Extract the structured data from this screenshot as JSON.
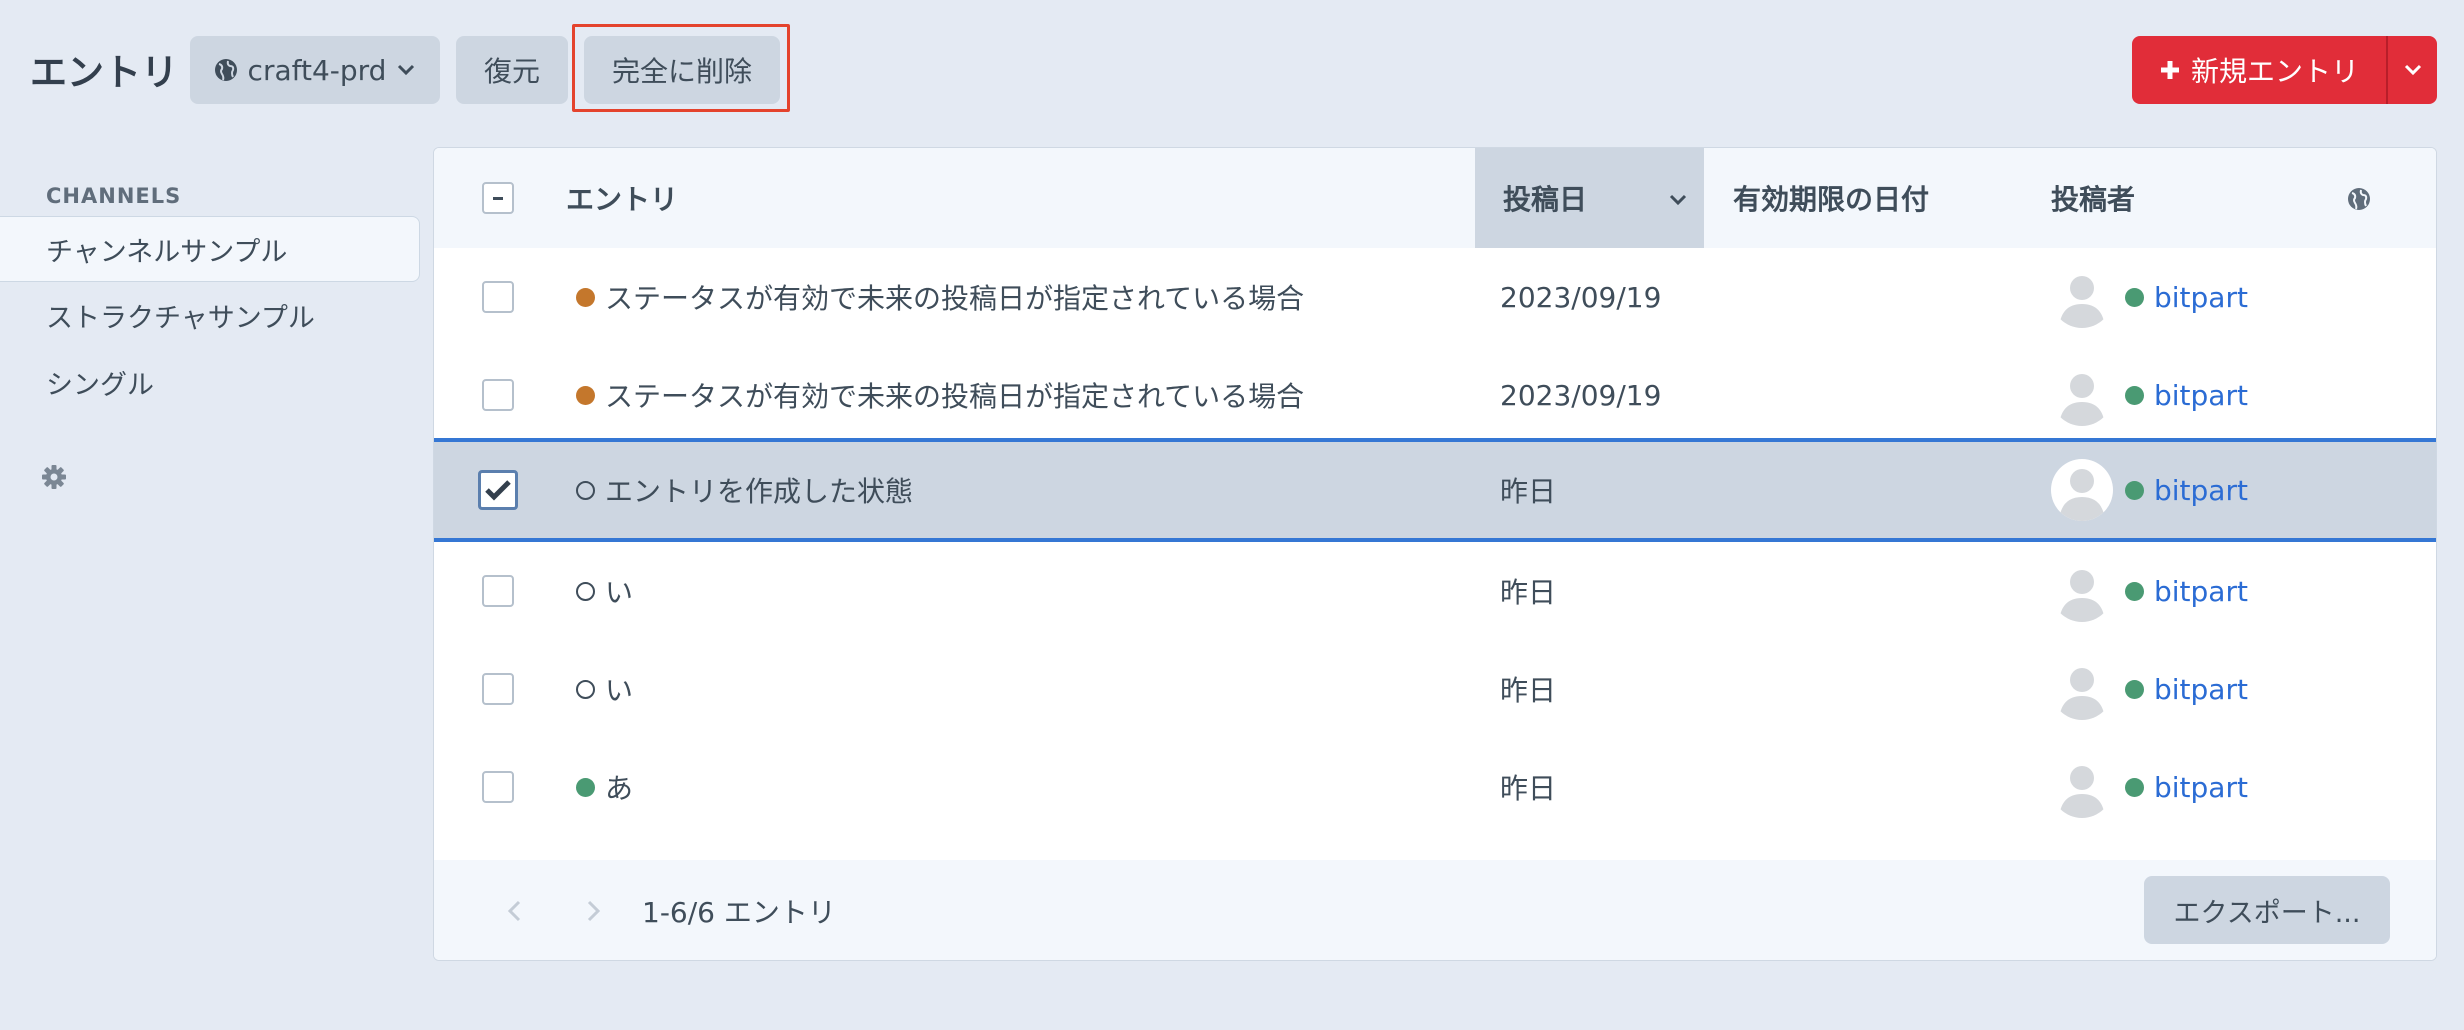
{
  "header": {
    "title": "エントリ",
    "site_label": "craft4-prd",
    "restore_label": "復元",
    "delete_label": "完全に削除",
    "new_entry_label": "新規エントリ"
  },
  "sidebar": {
    "heading": "CHANNELS",
    "items": [
      {
        "label": "チャンネルサンプル",
        "active": true
      },
      {
        "label": "ストラクチャサンプル",
        "active": false
      },
      {
        "label": "シングル",
        "active": false
      }
    ]
  },
  "table": {
    "columns": {
      "entry": "エントリ",
      "post_date": "投稿日",
      "expiry_date": "有効期限の日付",
      "author": "投稿者"
    },
    "rows": [
      {
        "title": "ステータスが有効で未来の投稿日が指定されている場合",
        "status": "live",
        "post_date": "2023/09/19",
        "expiry": "",
        "author": "bitpart",
        "checked": false
      },
      {
        "title": "ステータスが有効で未来の投稿日が指定されている場合",
        "status": "live",
        "post_date": "2023/09/19",
        "expiry": "",
        "author": "bitpart",
        "checked": false
      },
      {
        "title": "エントリを作成した状態",
        "status": "empty",
        "post_date": "昨日",
        "expiry": "",
        "author": "bitpart",
        "checked": true
      },
      {
        "title": "い",
        "status": "empty",
        "post_date": "昨日",
        "expiry": "",
        "author": "bitpart",
        "checked": false
      },
      {
        "title": "い",
        "status": "empty",
        "post_date": "昨日",
        "expiry": "",
        "author": "bitpart",
        "checked": false
      },
      {
        "title": "あ",
        "status": "enabled",
        "post_date": "昨日",
        "expiry": "",
        "author": "bitpart",
        "checked": false
      }
    ]
  },
  "footer": {
    "count_text": "1-6/6 エントリ",
    "export_label": "エクスポート..."
  },
  "colors": {
    "accent_red": "#e12d39",
    "highlight_border": "#e4432d",
    "selection_blue": "#3577d4",
    "live_status": "#c4772c",
    "enabled_status": "#4a9a73",
    "link_blue": "#2b6cd4"
  }
}
